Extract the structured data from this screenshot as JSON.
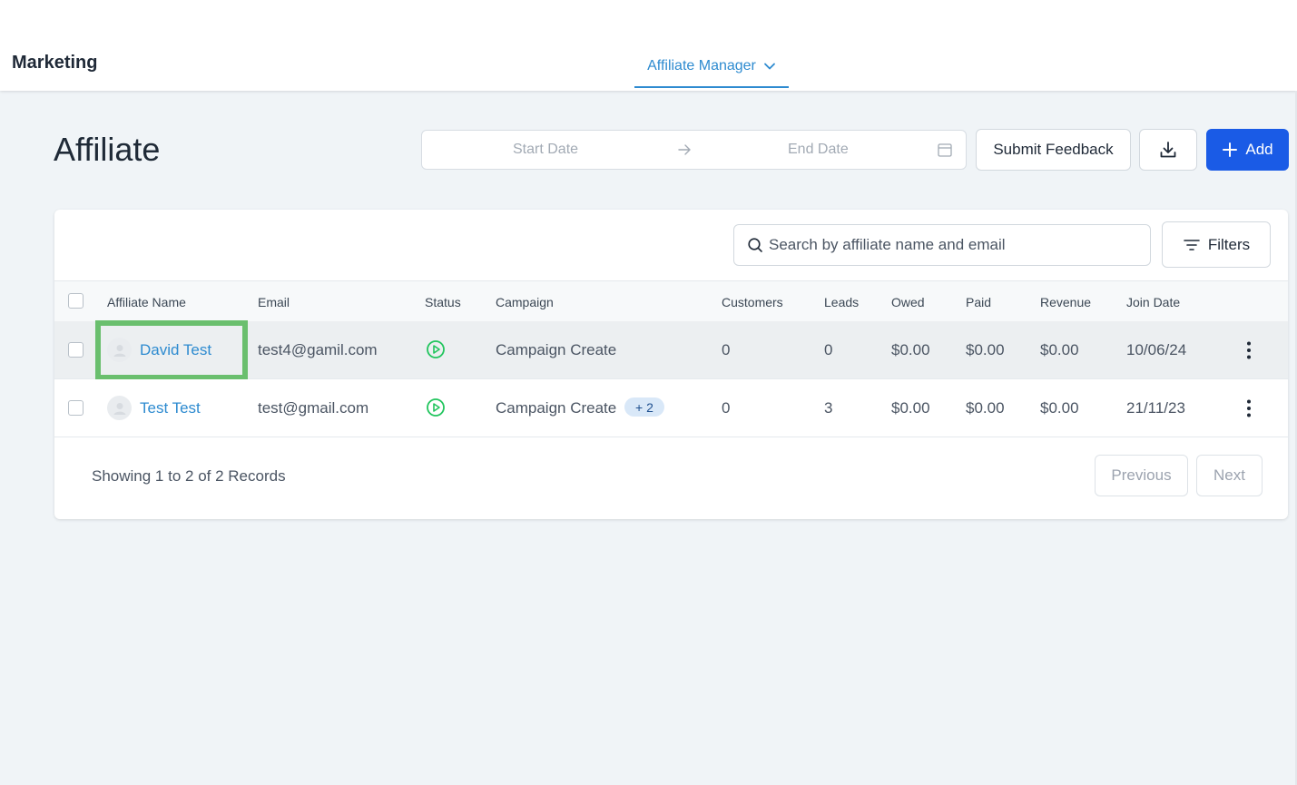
{
  "header": {
    "brand": "Marketing",
    "nav_tab": "Affiliate Manager"
  },
  "page": {
    "title": "Affiliate"
  },
  "date_range": {
    "start_placeholder": "Start Date",
    "end_placeholder": "End Date"
  },
  "actions": {
    "feedback_label": "Submit Feedback",
    "add_label": "Add"
  },
  "search": {
    "placeholder": "Search by affiliate name and email"
  },
  "filters_label": "Filters",
  "table": {
    "columns": [
      "Affiliate Name",
      "Email",
      "Status",
      "Campaign",
      "Customers",
      "Leads",
      "Owed",
      "Paid",
      "Revenue",
      "Join Date"
    ],
    "rows": [
      {
        "name": "David Test",
        "email": "test4@gamil.com",
        "campaign": "Campaign Create",
        "extra_campaigns": "",
        "customers": "0",
        "leads": "0",
        "owed": "$0.00",
        "paid": "$0.00",
        "revenue": "$0.00",
        "join_date": "10/06/24"
      },
      {
        "name": "Test Test",
        "email": "test@gmail.com",
        "campaign": "Campaign Create",
        "extra_campaigns": "+ 2",
        "customers": "0",
        "leads": "3",
        "owed": "$0.00",
        "paid": "$0.00",
        "revenue": "$0.00",
        "join_date": "21/11/23"
      }
    ]
  },
  "footer": {
    "records_text": "Showing 1 to 2 of 2 Records",
    "previous_label": "Previous",
    "next_label": "Next"
  },
  "colors": {
    "accent": "#2e8bd0",
    "primary_button": "#1a5be6",
    "status_active": "#22c55e",
    "highlight": "#6abf6e"
  },
  "icons": {
    "nav_chevron": "chevron-down-icon",
    "date_arrow": "arrow-right-icon",
    "calendar": "calendar-icon",
    "download": "download-icon",
    "add": "plus-icon",
    "search": "search-icon",
    "filters": "filter-lines-icon",
    "status": "play-circle-icon",
    "row_menu": "kebab-menu-icon",
    "avatar": "user-avatar-icon"
  }
}
